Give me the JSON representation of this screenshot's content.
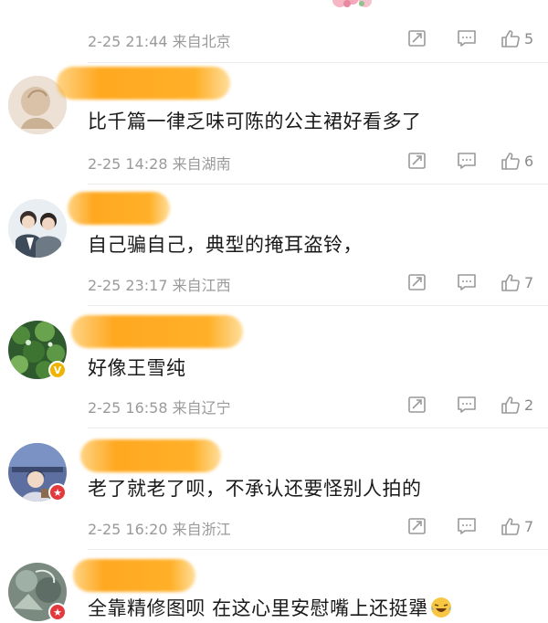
{
  "comments": [
    {
      "time": "2-25 21:44",
      "location": "来自北京",
      "likes": "5"
    },
    {
      "text": "比千篇一律乏味可陈的公主裙好看多了",
      "time": "2-25 14:28",
      "location": "来自湖南",
      "likes": "6"
    },
    {
      "text": "自己骗自己，典型的掩耳盗铃，",
      "time": "2-25 23:17",
      "location": "来自江西",
      "likes": "7"
    },
    {
      "text": "好像王雪纯",
      "time": "2-25 16:58",
      "location": "来自辽宁",
      "likes": "2"
    },
    {
      "text": "老了就老了呗，不承认还要怪别人拍的",
      "time": "2-25 16:20",
      "location": "来自浙江",
      "likes": "7"
    },
    {
      "text": "全靠精修图呗 在这心里安慰嘴上还挺犟"
    }
  ],
  "icons": {
    "repost": "repost-icon",
    "comment": "comment-icon",
    "like": "thumbs-up-icon",
    "verified": "verified-badge-icon",
    "emoji": "laughing-crying-emoji-icon"
  },
  "colors": {
    "mask": "#ffa820",
    "meta": "#9a9a9a",
    "badge_gold": "#f0b400",
    "badge_red": "#e4393c"
  }
}
